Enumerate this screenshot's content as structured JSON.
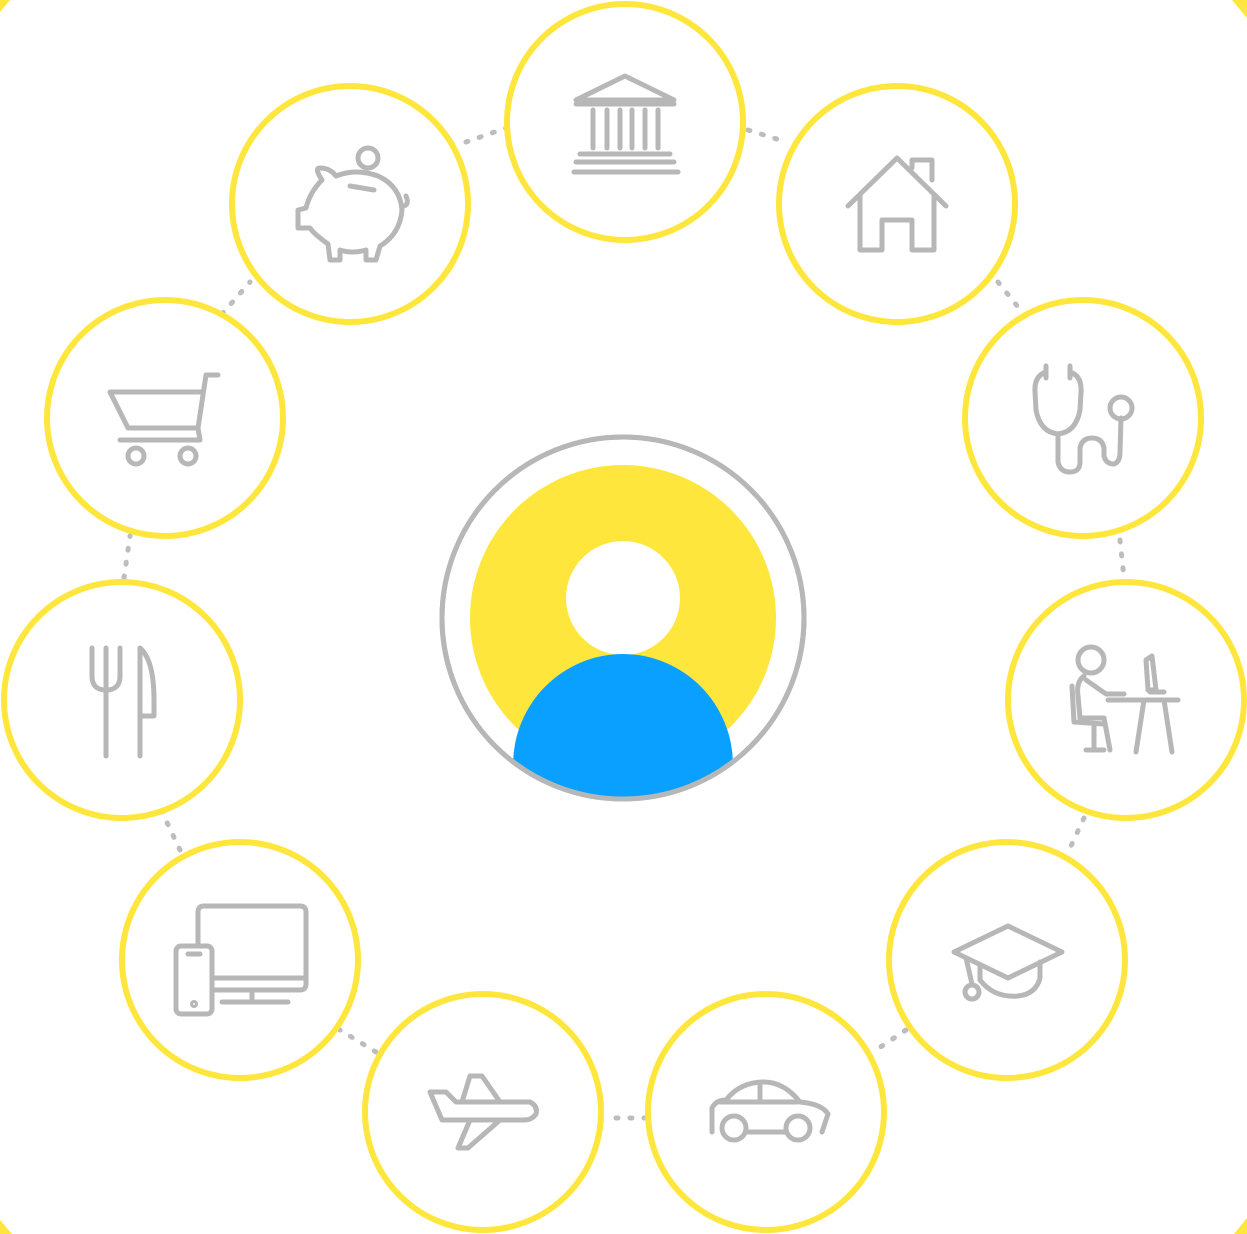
{
  "colors": {
    "ring": "#FFE63C",
    "icon": "#B7B7B7",
    "connector": "#BDBDBD",
    "center_ring": "#B7B7B7",
    "avatar_head_bg": "#FFE63C",
    "avatar_body": "#0AA0FF",
    "background": "#FFFFFF"
  },
  "center": {
    "icon": "user-avatar-icon"
  },
  "nodes": [
    {
      "id": "bank",
      "icon": "bank-icon"
    },
    {
      "id": "home",
      "icon": "house-icon"
    },
    {
      "id": "health",
      "icon": "stethoscope-icon"
    },
    {
      "id": "work",
      "icon": "person-at-desk-icon"
    },
    {
      "id": "education",
      "icon": "graduation-cap-icon"
    },
    {
      "id": "car",
      "icon": "car-icon"
    },
    {
      "id": "travel",
      "icon": "airplane-icon"
    },
    {
      "id": "devices",
      "icon": "computer-phone-icon"
    },
    {
      "id": "dining",
      "icon": "fork-knife-icon"
    },
    {
      "id": "shopping",
      "icon": "shopping-cart-icon"
    },
    {
      "id": "savings",
      "icon": "piggy-bank-icon"
    }
  ]
}
